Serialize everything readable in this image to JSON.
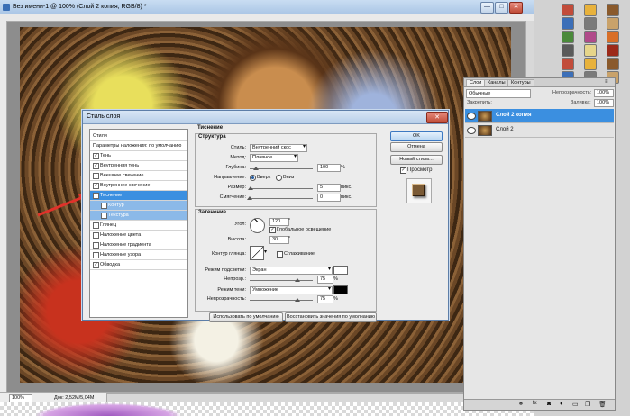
{
  "window": {
    "title": "Без имени-1 @ 100% (Слой 2 копия, RGB/8) *",
    "minimize": "—",
    "maximize": "□",
    "close": "✕"
  },
  "status": {
    "zoom": "100%",
    "doc": "Док: 2,52M/5,04M"
  },
  "layers_panel": {
    "tabs": [
      "Слои",
      "Каналы",
      "Контуры"
    ],
    "blend_mode": "Обычные",
    "opacity_label": "Непрозрачность:",
    "opacity_value": "100%",
    "fill_label": "Заливка:",
    "fill_value": "100%",
    "lock_label": "Закрепить:",
    "layers": [
      {
        "name": "Слой 2 копия",
        "selected": true
      },
      {
        "name": "Слой 2",
        "selected": false
      }
    ]
  },
  "dialog": {
    "title": "Стиль слоя",
    "close": "✕",
    "style_list": {
      "styles_header": "Стили",
      "blend_options": "Параметры наложения: по умолчанию",
      "items": [
        {
          "label": "Тень",
          "checked": true
        },
        {
          "label": "Внутренняя тень",
          "checked": true
        },
        {
          "label": "Внешнее свечение",
          "checked": false
        },
        {
          "label": "Внутреннее свечение",
          "checked": true
        },
        {
          "label": "Тиснение",
          "checked": true,
          "selected": true
        },
        {
          "label": "Контур",
          "checked": false,
          "sub": true
        },
        {
          "label": "Текстура",
          "checked": false,
          "sub": true
        },
        {
          "label": "Глянец",
          "checked": false
        },
        {
          "label": "Наложение цвета",
          "checked": false
        },
        {
          "label": "Наложение градиента",
          "checked": false
        },
        {
          "label": "Наложение узора",
          "checked": false
        },
        {
          "label": "Обводка",
          "checked": true
        }
      ]
    },
    "section_title": "Тиснение",
    "structure": {
      "title": "Структура",
      "style_label": "Стиль:",
      "style_value": "Внутренний скос",
      "method_label": "Метод:",
      "method_value": "Плавное",
      "depth_label": "Глубина:",
      "depth_value": "100",
      "depth_unit": "%",
      "depth_fraction": 0.1,
      "direction_label": "Направление:",
      "direction_up": "Вверх",
      "direction_down": "Вниз",
      "size_label": "Размер:",
      "size_value": "5",
      "size_unit": "пикс.",
      "soften_label": "Смягчение:",
      "soften_value": "0",
      "soften_unit": "пикс."
    },
    "shading": {
      "title": "Затенение",
      "angle_label": "Угол:",
      "angle_value": "120",
      "angle_unit": "°",
      "global_light": "Глобальное освещение",
      "altitude_label": "Высота:",
      "altitude_value": "30",
      "altitude_unit": "°",
      "gloss_label": "Контур глянца:",
      "antialias": "Сглаживание",
      "highlight_label": "Режим подсветки:",
      "highlight_mode": "Экран",
      "highlight_color": "#ffffff",
      "h_opacity_label": "Непрозр.:",
      "h_opacity_value": "75",
      "h_opacity_unit": "%",
      "h_opacity_fraction": 0.75,
      "shadow_label": "Режим тени:",
      "shadow_mode": "Умножение",
      "shadow_color": "#000000",
      "s_opacity_label": "Непрозрачность:",
      "s_opacity_value": "75",
      "s_opacity_unit": "%",
      "s_opacity_fraction": 0.75
    },
    "buttons": {
      "ok": "OK",
      "cancel": "Отмена",
      "new_style": "Новый стиль...",
      "preview": "Просмотр",
      "make_default": "Использовать по умолчанию",
      "reset_default": "Восстановить значения по умолчанию"
    }
  },
  "colors": {
    "selection_blue": "#3b8fe0",
    "arrow_red": "#e0322a"
  }
}
